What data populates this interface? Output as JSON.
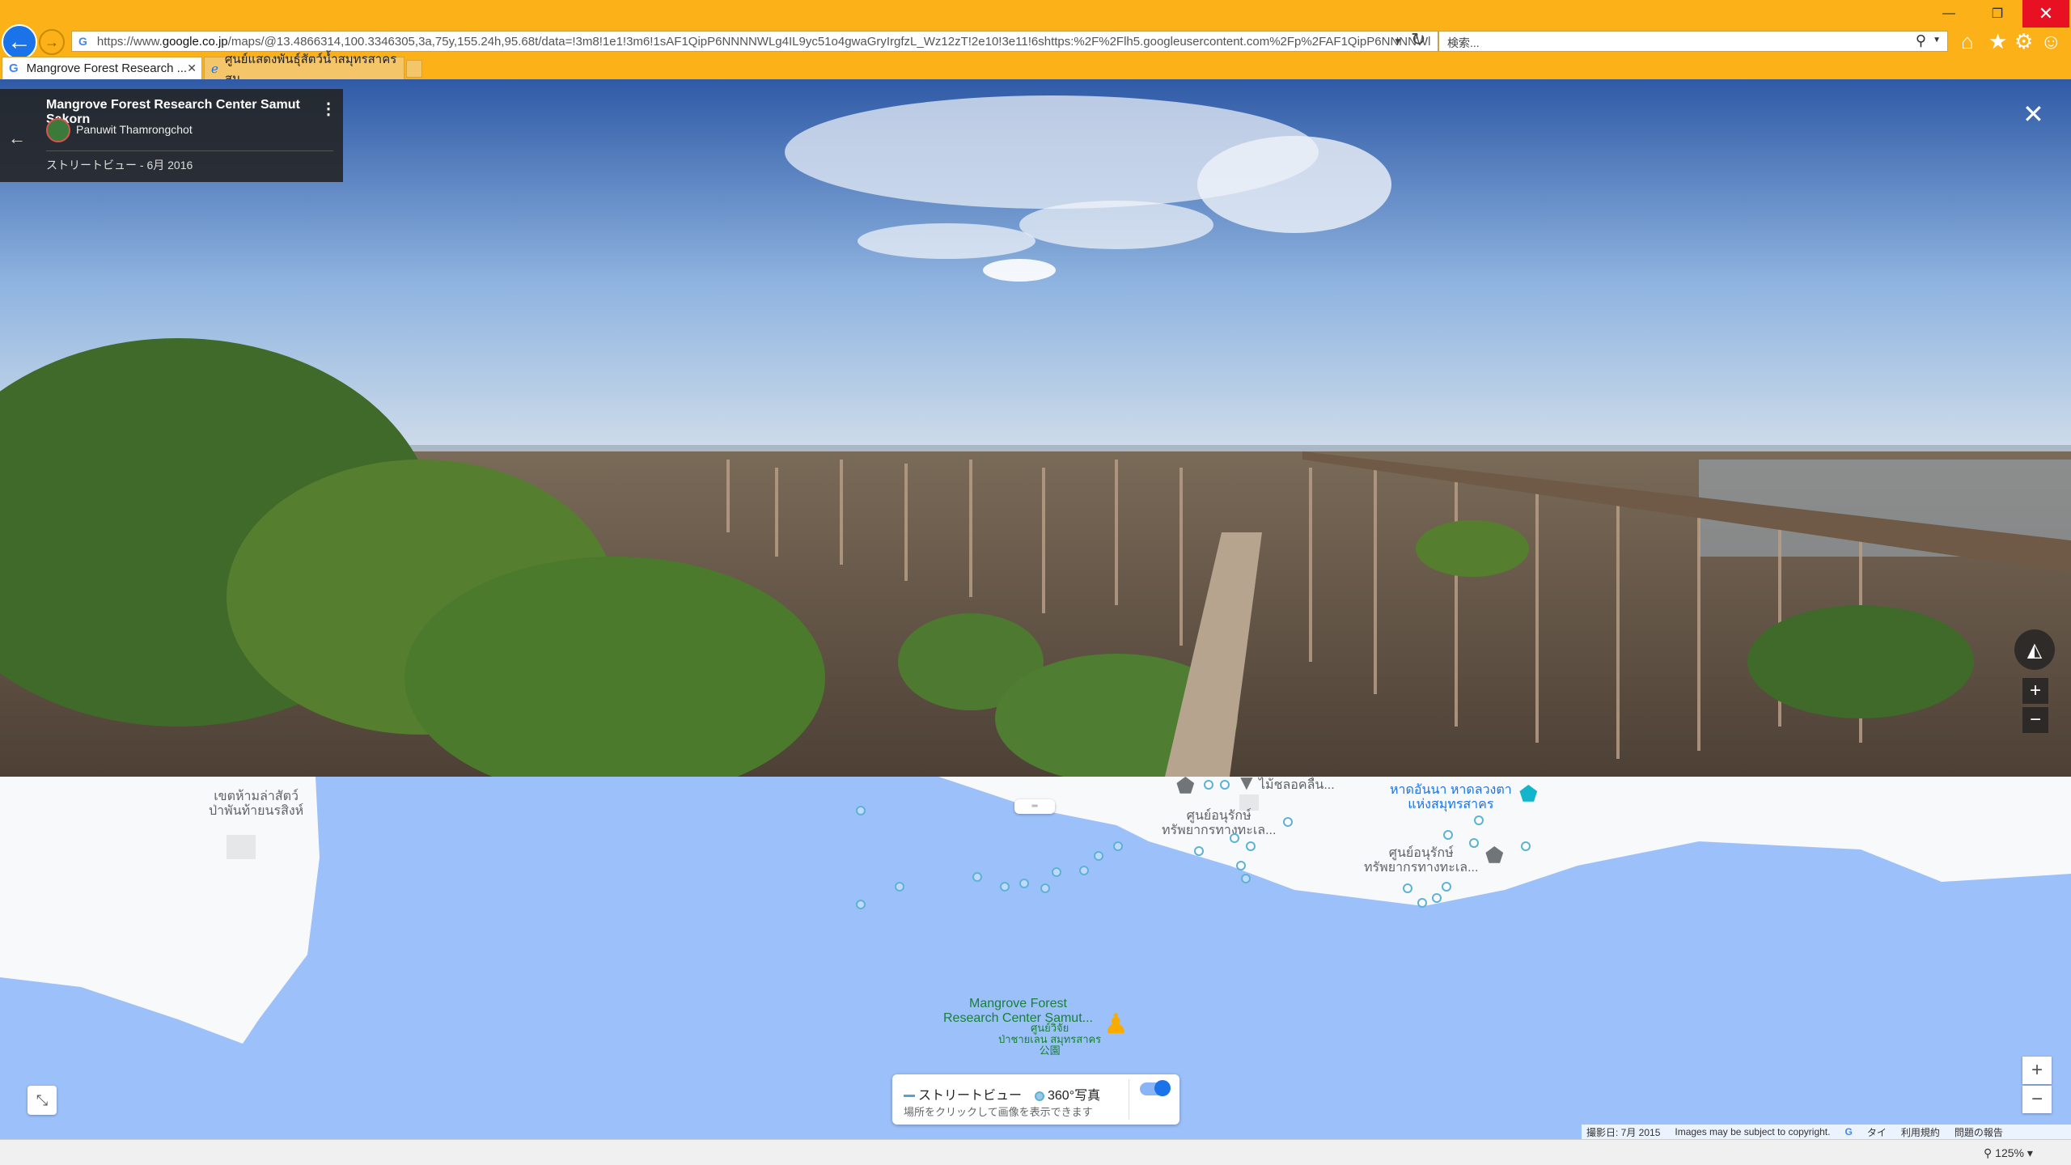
{
  "browser": {
    "url_domain_prefix": "https://www.",
    "url_domain": "google.co.jp",
    "url_rest": "/maps/@13.4866314,100.3346305,3a,75y,155.24h,95.68t/data=!3m8!1e1!3m6!1sAF1QipP6NNNNWLg4IL9yc51o4gwaGryIrgfzL_Wz12zT!2e10!3e11!6shttps:%2F%2Flh5.googleusercontent.com%2Fp%2FAF1QipP6NNNNWl",
    "search_placeholder": "検索...",
    "tabs": [
      {
        "label": "Mangrove Forest Research ..."
      },
      {
        "label": "ศูนย์แสดงพันธุ์สัตว์น้ำสมุทรสาคร สม..."
      }
    ]
  },
  "streetview": {
    "title": "Mangrove Forest Research Center Samut Sakorn",
    "author": "Panuwit Thamrongchot",
    "date": "ストリートビュー - 6月 2016"
  },
  "map": {
    "labels": [
      {
        "text": "เขตห้ามล่าสัตว์\nป่าพันท้ายนรสิงห์",
        "color": "gray"
      },
      {
        "text": "ศูนย์อนุรักษ์\nทรัพยากรทางทะเล...",
        "color": "gray"
      },
      {
        "text": "ไม้ชลอคลื่น...",
        "color": "gray"
      },
      {
        "text": "หาดอันนา หาดลวงตา\nแห่งสมุทรสาคร",
        "color": "blue"
      },
      {
        "text": "ศูนย์อนุรักษ์\nทรัพยากรทางทะเล...",
        "color": "gray"
      },
      {
        "text": "Mangrove Forest\nResearch Center Samut...",
        "color": "green"
      },
      {
        "text": "ศูนย์วิจัย\nป่าชายเลน สมุทรสาคร\n公園",
        "color": "green"
      }
    ]
  },
  "legend": {
    "streetview": "ストリートビュー",
    "photo360": "360°写真",
    "hint": "場所をクリックして画像を表示できます"
  },
  "footer": {
    "capture_date": "撮影日: 7月 2015",
    "copyright": "Images may be subject to copyright.",
    "google": "G",
    "country": "タイ",
    "terms": "利用規約",
    "report": "問題の報告"
  },
  "status": {
    "zoom": "125%"
  }
}
